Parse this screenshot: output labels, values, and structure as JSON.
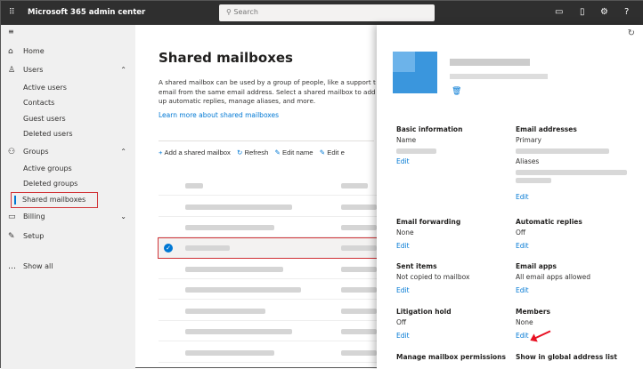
{
  "header": {
    "app_title": "Microsoft 365 admin center",
    "search_placeholder": "Search"
  },
  "sidebar": {
    "items": [
      {
        "label": "Home",
        "icon": "home-icon"
      },
      {
        "label": "Users",
        "icon": "user-icon"
      },
      {
        "label": "Active users"
      },
      {
        "label": "Contacts"
      },
      {
        "label": "Guest users"
      },
      {
        "label": "Deleted users"
      },
      {
        "label": "Groups",
        "icon": "groups-icon"
      },
      {
        "label": "Active groups"
      },
      {
        "label": "Deleted groups"
      },
      {
        "label": "Shared mailboxes"
      },
      {
        "label": "Billing",
        "icon": "billing-icon"
      },
      {
        "label": "Setup",
        "icon": "wrench-icon"
      },
      {
        "label": "Show all"
      }
    ]
  },
  "main": {
    "title": "Shared mailboxes",
    "description": [
      "A shared mailbox can be used by a group of people, like a support t",
      "email from the same email address. Select a shared mailbox to add",
      "up automatic replies, manage aliases, and more."
    ],
    "learn_more": "Learn more about shared mailboxes",
    "toolbar": {
      "add": "Add a shared mailbox",
      "refresh": "Refresh",
      "edit_name": "Edit name",
      "edit_email": "Edit e"
    }
  },
  "panel": {
    "sections": [
      {
        "title": "Basic information",
        "label": "Name",
        "edit": "Edit"
      },
      {
        "title": "Email addresses",
        "label": "Primary",
        "label2": "Aliases",
        "edit": "Edit"
      },
      {
        "title": "Email forwarding",
        "value": "None",
        "edit": "Edit"
      },
      {
        "title": "Automatic replies",
        "value": "Off",
        "edit": "Edit"
      },
      {
        "title": "Sent items",
        "value": "Not copied to mailbox",
        "edit": "Edit"
      },
      {
        "title": "Email apps",
        "value": "All email apps allowed",
        "edit": "Edit"
      },
      {
        "title": "Litigation hold",
        "value": "Off",
        "edit": "Edit"
      },
      {
        "title": "Members",
        "value": "None",
        "edit": "Edit"
      },
      {
        "title": "Manage mailbox permissions"
      },
      {
        "title": "Show in global address list"
      }
    ]
  }
}
